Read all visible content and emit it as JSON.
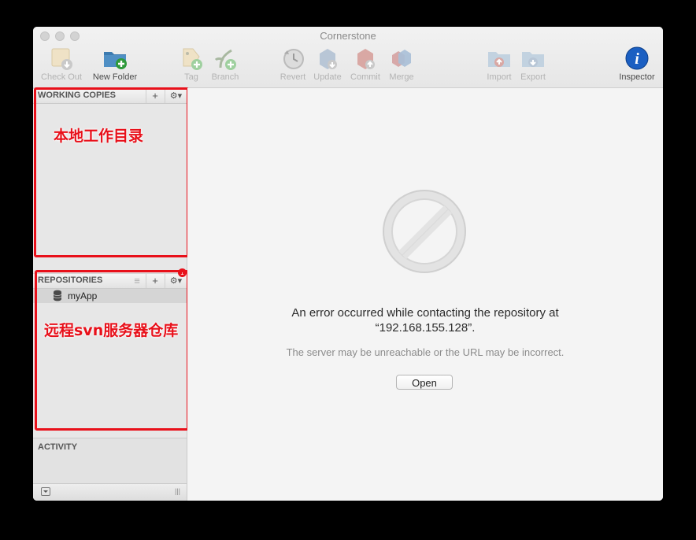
{
  "window": {
    "title": "Cornerstone"
  },
  "toolbar": {
    "check_out": "Check Out",
    "new_folder": "New Folder",
    "tag": "Tag",
    "branch": "Branch",
    "revert": "Revert",
    "update": "Update",
    "commit": "Commit",
    "merge": "Merge",
    "import": "Import",
    "export": "Export",
    "inspector": "Inspector"
  },
  "sidebar": {
    "working_copies": {
      "title": "WORKING COPIES",
      "add": "+",
      "gear": "⚙▾"
    },
    "repositories": {
      "title": "REPOSITORIES",
      "list": "≡",
      "add": "+",
      "gear": "⚙▾",
      "badge": "1",
      "items": [
        {
          "label": "myApp"
        }
      ]
    },
    "activity": {
      "title": "ACTIVITY"
    },
    "bottom": {
      "resize": "|||"
    }
  },
  "annotations": {
    "working_copies_note": "本地工作目录",
    "repositories_note": "远程svn服务器仓库"
  },
  "main": {
    "error_line1": "An error occurred while contacting the repository at",
    "error_line2": "“192.168.155.128”.",
    "error_detail": "The server may be unreachable or the URL may be incorrect.",
    "open_label": "Open"
  },
  "colors": {
    "annotation_red": "#e8101a",
    "inspector_blue": "#1b5fc2",
    "new_folder_blue": "#3c7bb0"
  }
}
